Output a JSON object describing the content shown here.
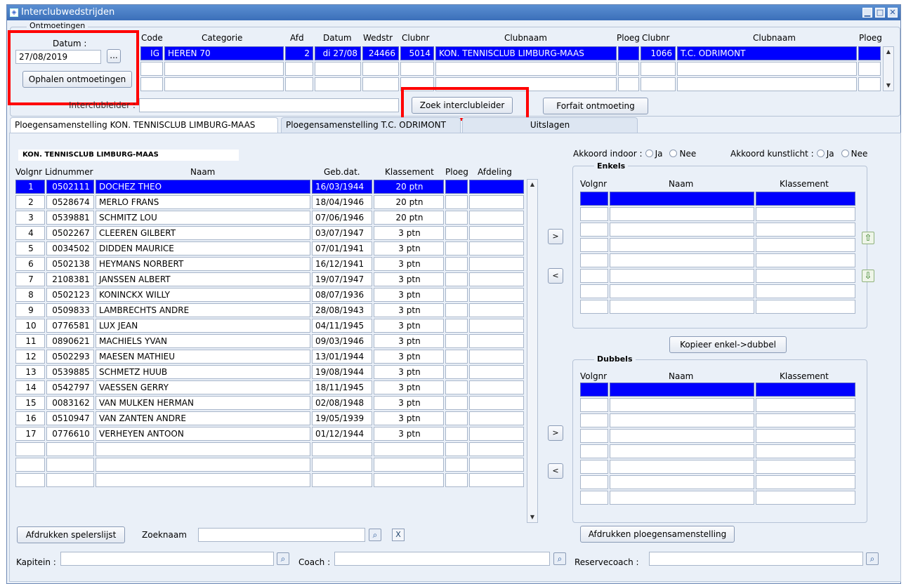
{
  "window": {
    "title": "Interclubwedstrijden",
    "minimize": "▁",
    "maximize": "□",
    "close": "✕"
  },
  "ontmoetingen": {
    "group_label": "Ontmoetingen",
    "datum_label": "Datum :",
    "datum_value": "27/08/2019",
    "datum_button": "...",
    "ophalen_button": "Ophalen ontmoetingen",
    "headers": [
      "Code",
      "Categorie",
      "Afd",
      "Datum",
      "Wedstr",
      "Clubnr",
      "Clubnaam",
      "Ploeg",
      "Clubnr",
      "Clubnaam",
      "Ploeg"
    ],
    "row": {
      "code": "IG",
      "categorie": "HEREN 70",
      "afd": "2",
      "datum": "di 27/08",
      "wedstr": "24466",
      "clubnr1": "5014",
      "clubnaam1": "KON. TENNISCLUB LIMBURG-MAAS",
      "ploeg1": "",
      "clubnr2": "1066",
      "clubnaam2": "T.C. ODRIMONT",
      "ploeg2": ""
    },
    "interclubleider_label": "Interclubleider :",
    "interclubleider_value": "",
    "zoek_button": "Zoek interclubleider",
    "forfait_button": "Forfait ontmoeting"
  },
  "tabs": [
    {
      "label": "Ploegensamenstelling KON. TENNISCLUB LIMBURG-MAAS"
    },
    {
      "label": "Ploegensamenstelling T.C. ODRIMONT"
    },
    {
      "label": "Uitslagen"
    }
  ],
  "club_name": "KON. TENNISCLUB LIMBURG-MAAS",
  "players": {
    "headers": {
      "volgnr": "Volgnr",
      "lidnummer": "Lidnummer",
      "naam": "Naam",
      "gebdat": "Geb.dat.",
      "klassement": "Klassement",
      "ploeg": "Ploeg",
      "afdeling": "Afdeling"
    },
    "rows": [
      {
        "volgnr": "1",
        "lid": "0502111",
        "naam": "DOCHEZ THEO",
        "geb": "16/03/1944",
        "klas": "20 ptn"
      },
      {
        "volgnr": "2",
        "lid": "0528674",
        "naam": "MERLO FRANS",
        "geb": "18/04/1946",
        "klas": "20 ptn"
      },
      {
        "volgnr": "3",
        "lid": "0539881",
        "naam": "SCHMITZ LOU",
        "geb": "07/06/1946",
        "klas": "20 ptn"
      },
      {
        "volgnr": "4",
        "lid": "0502267",
        "naam": "CLEEREN GILBERT",
        "geb": "03/07/1947",
        "klas": "3 ptn"
      },
      {
        "volgnr": "5",
        "lid": "0034502",
        "naam": "DIDDEN MAURICE",
        "geb": "07/01/1941",
        "klas": "3 ptn"
      },
      {
        "volgnr": "6",
        "lid": "0502138",
        "naam": "HEYMANS NORBERT",
        "geb": "16/12/1941",
        "klas": "3 ptn"
      },
      {
        "volgnr": "7",
        "lid": "2108381",
        "naam": "JANSSEN ALBERT",
        "geb": "19/07/1947",
        "klas": "3 ptn"
      },
      {
        "volgnr": "8",
        "lid": "0502123",
        "naam": "KONINCKX WILLY",
        "geb": "08/07/1936",
        "klas": "3 ptn"
      },
      {
        "volgnr": "9",
        "lid": "0509833",
        "naam": "LAMBRECHTS ANDRE",
        "geb": "28/08/1943",
        "klas": "3 ptn"
      },
      {
        "volgnr": "10",
        "lid": "0776581",
        "naam": "LUX JEAN",
        "geb": "04/11/1945",
        "klas": "3 ptn"
      },
      {
        "volgnr": "11",
        "lid": "0890621",
        "naam": "MACHIELS YVAN",
        "geb": "09/03/1946",
        "klas": "3 ptn"
      },
      {
        "volgnr": "12",
        "lid": "0502293",
        "naam": "MAESEN MATHIEU",
        "geb": "13/01/1944",
        "klas": "3 ptn"
      },
      {
        "volgnr": "13",
        "lid": "0539885",
        "naam": "SCHMETZ HUUB",
        "geb": "19/08/1944",
        "klas": "3 ptn"
      },
      {
        "volgnr": "14",
        "lid": "0542797",
        "naam": "VAESSEN GERRY",
        "geb": "18/11/1945",
        "klas": "3 ptn"
      },
      {
        "volgnr": "15",
        "lid": "0083162",
        "naam": "VAN MULKEN HERMAN",
        "geb": "02/08/1948",
        "klas": "3 ptn"
      },
      {
        "volgnr": "16",
        "lid": "0510947",
        "naam": "VAN ZANTEN ANDRE",
        "geb": "19/05/1939",
        "klas": "3 ptn"
      },
      {
        "volgnr": "17",
        "lid": "0776610",
        "naam": "VERHEYEN ANTOON",
        "geb": "01/12/1944",
        "klas": "3 ptn"
      },
      {
        "volgnr": "",
        "lid": "",
        "naam": "",
        "geb": "",
        "klas": ""
      },
      {
        "volgnr": "",
        "lid": "",
        "naam": "",
        "geb": "",
        "klas": ""
      },
      {
        "volgnr": "",
        "lid": "",
        "naam": "",
        "geb": "",
        "klas": ""
      }
    ]
  },
  "akkoord_indoor_label": "Akkoord indoor :",
  "akkoord_kunstlicht_label": "Akkoord kunstlicht :",
  "ja": "Ja",
  "nee": "Nee",
  "enkels": {
    "label": "Enkels",
    "headers": [
      "Volgnr",
      "Naam",
      "Klassement"
    ]
  },
  "dubbels": {
    "label": "Dubbels",
    "headers": [
      "Volgnr",
      "Naam",
      "Klassement"
    ]
  },
  "move_right": ">",
  "move_left": "<",
  "kopieer_button": "Kopieer enkel->dubbel",
  "afdrukken_spelerslijst": "Afdrukken spelerslijst",
  "zoeknaam_label": "Zoeknaam",
  "afdrukken_ploeg": "Afdrukken ploegensamenstelling",
  "kapitein_label": "Kapitein :",
  "coach_label": "Coach :",
  "reservecoach_label": "Reservecoach :",
  "icons": {
    "search": "search-icon",
    "clear": "clear-icon",
    "up": "arrow-up-icon",
    "down": "arrow-down-icon"
  },
  "colors": {
    "selection": "#0000ff",
    "highlight": "#ff0000",
    "titlebar": "#3b6fb9"
  }
}
